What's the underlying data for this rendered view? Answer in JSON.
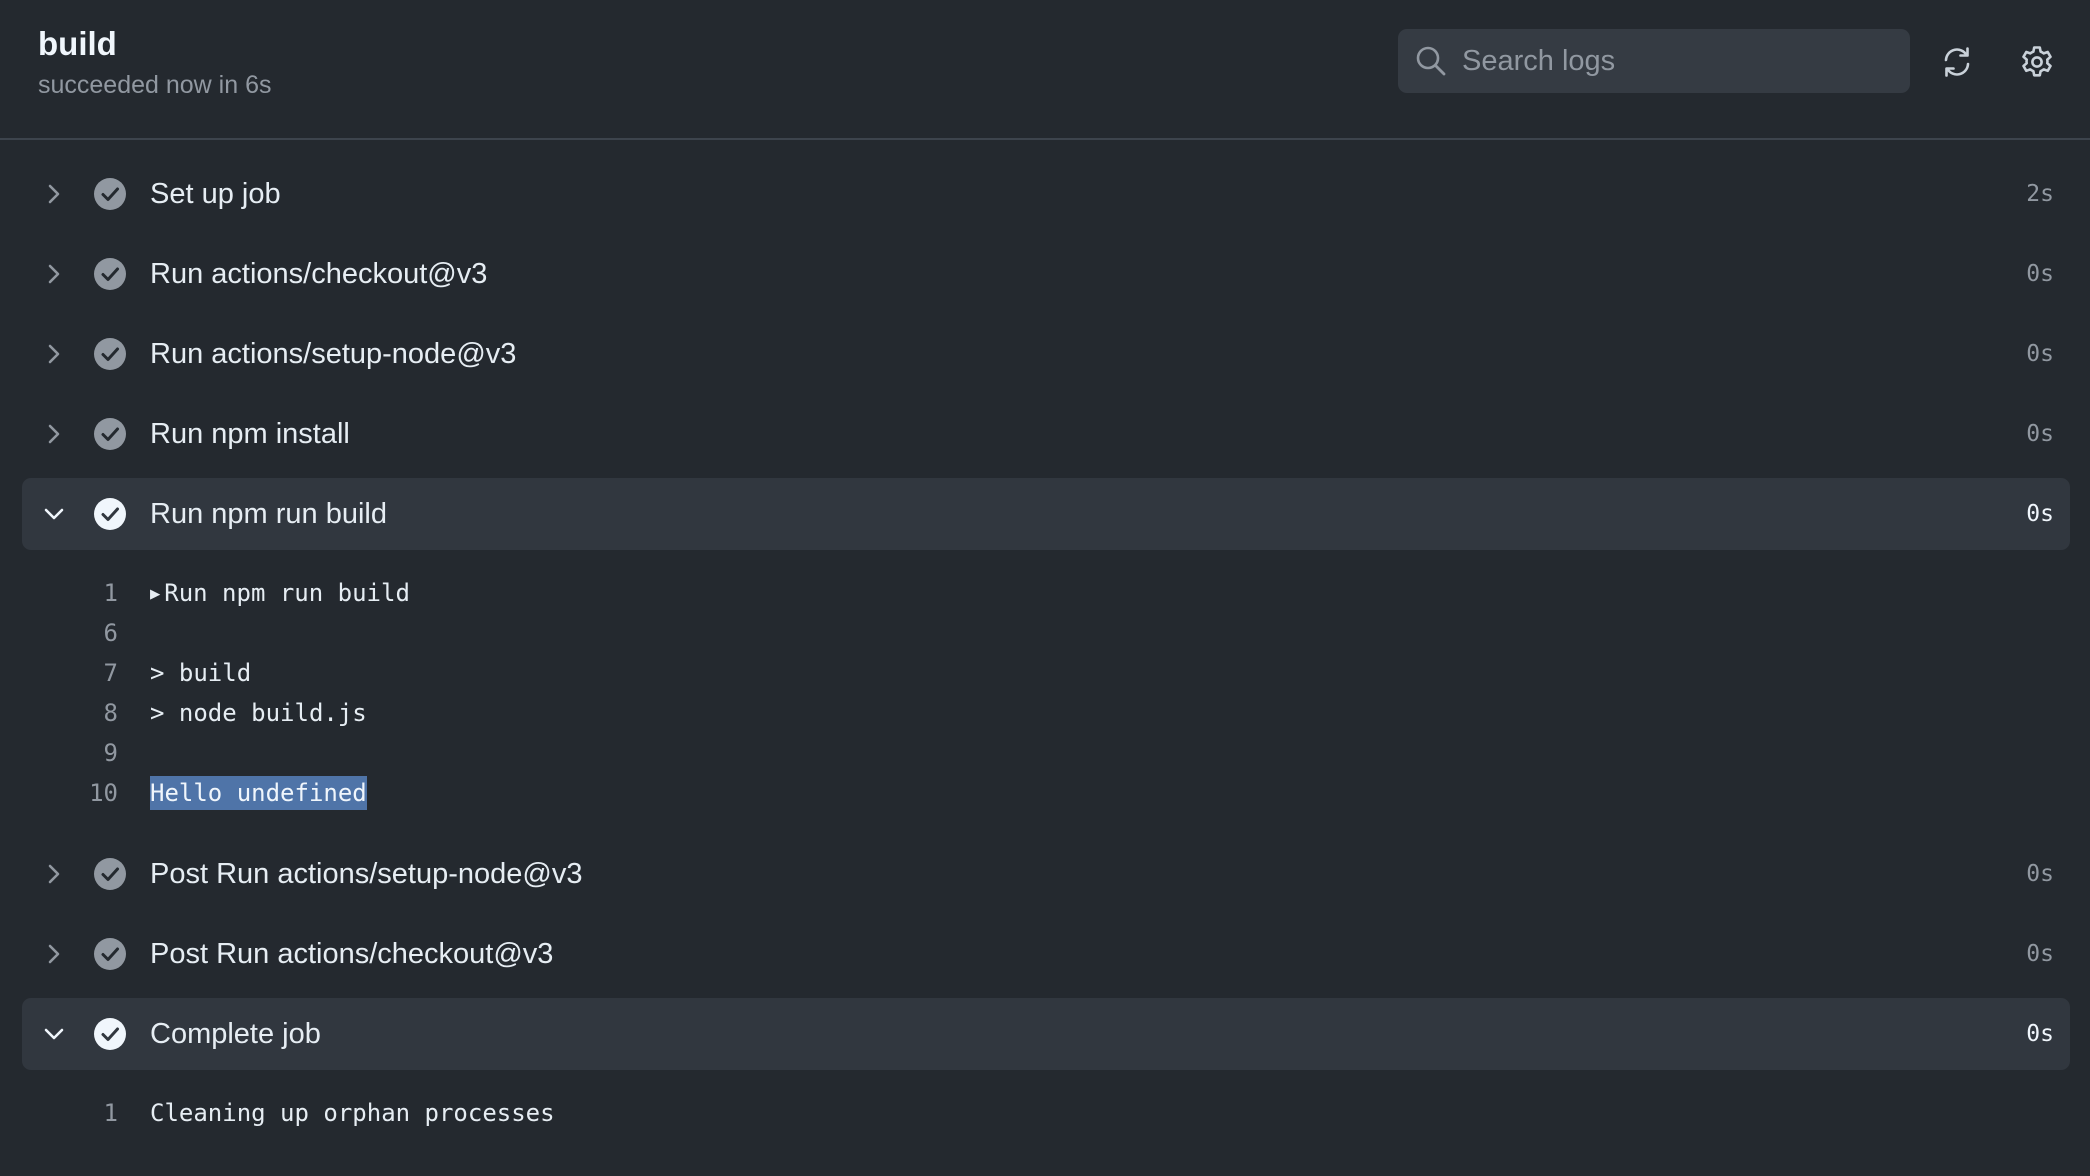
{
  "job": {
    "title": "build",
    "status": "succeeded now in 6s"
  },
  "search": {
    "placeholder": "Search logs"
  },
  "colors": {
    "background": "#24292f",
    "expanded_row": "#31373f",
    "muted_text": "#9198a1",
    "selection": "#4f74a8"
  },
  "steps": [
    {
      "name": "Set up job",
      "duration": "2s",
      "expanded": false,
      "icon": "check-circle-icon"
    },
    {
      "name": "Run actions/checkout@v3",
      "duration": "0s",
      "expanded": false,
      "icon": "check-circle-icon"
    },
    {
      "name": "Run actions/setup-node@v3",
      "duration": "0s",
      "expanded": false,
      "icon": "check-circle-icon"
    },
    {
      "name": "Run npm install",
      "duration": "0s",
      "expanded": false,
      "icon": "check-circle-icon"
    },
    {
      "name": "Run npm run build",
      "duration": "0s",
      "expanded": true,
      "icon": "check-circle-icon"
    },
    {
      "name": "Post Run actions/setup-node@v3",
      "duration": "0s",
      "expanded": false,
      "icon": "check-circle-icon"
    },
    {
      "name": "Post Run actions/checkout@v3",
      "duration": "0s",
      "expanded": false,
      "icon": "check-circle-icon"
    },
    {
      "name": "Complete job",
      "duration": "0s",
      "expanded": true,
      "icon": "check-circle-icon"
    }
  ],
  "logs": {
    "build": [
      {
        "num": "1",
        "text": "Run npm run build",
        "group": true
      },
      {
        "num": "6",
        "text": ""
      },
      {
        "num": "7",
        "text": "> build"
      },
      {
        "num": "8",
        "text": "> node build.js"
      },
      {
        "num": "9",
        "text": ""
      },
      {
        "num": "10",
        "text": "Hello undefined",
        "selected": true
      }
    ],
    "complete": [
      {
        "num": "1",
        "text": "Cleaning up orphan processes"
      }
    ]
  }
}
